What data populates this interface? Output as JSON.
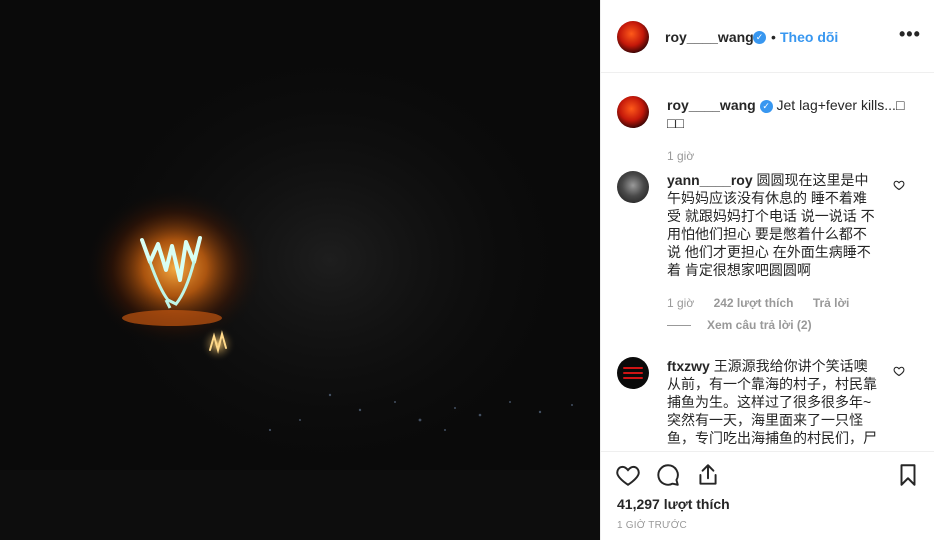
{
  "post": {
    "username": "roy____wang",
    "follow_label": "Theo dõi",
    "separator": "•",
    "more_label": "•••"
  },
  "caption": {
    "username": "roy____wang",
    "text": "Jet lag+fever kills...□□□",
    "time": "1 giờ"
  },
  "comments": [
    {
      "username": "yann____roy",
      "text": "圆圆现在这里是中午妈妈应该没有休息的 睡不着难受 就跟妈妈打个电话 说一说话 不用怕他们担心 要是憋着什么都不说 他们才更担心 在外面生病睡不着 肯定很想家吧圆圆啊",
      "time": "1 giờ",
      "likes": "242 lượt thích",
      "reply": "Trả lời",
      "view_replies": "Xem câu trả lời (2)"
    },
    {
      "username": "ftxzwy",
      "text": "王源源我给你讲个笑话噢 从前，有一个靠海的村子，村民靠捕鱼为生。这样过了很多很多年~突然有一天，海里面来了一只怪鱼，专门吃出海捕鱼的村民们，尸"
    }
  ],
  "footer": {
    "likes": "41,297 lượt thích",
    "time": "1 GIỜ TRƯỚC"
  },
  "icons": {
    "like": "heart-icon",
    "comment": "comment-icon",
    "share": "share-icon",
    "save": "bookmark-icon"
  },
  "colors": {
    "accent": "#3897f0",
    "text": "#262626",
    "muted": "#999999",
    "photo_glow": "#ff8a1a",
    "filament": "#d8fff4"
  }
}
